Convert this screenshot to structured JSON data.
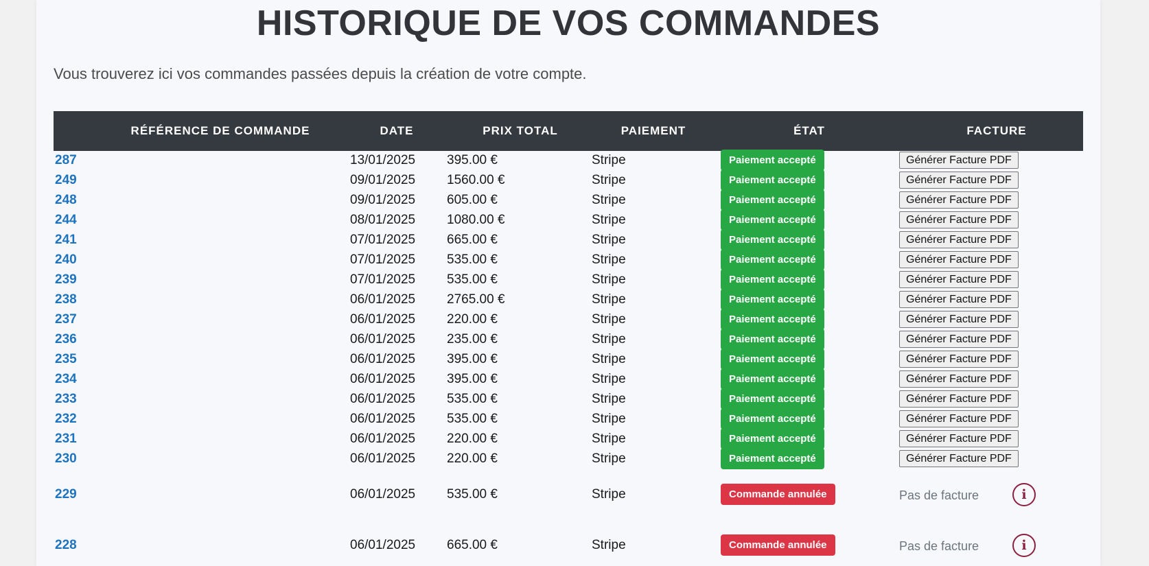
{
  "page": {
    "title": "HISTORIQUE DE VOS COMMANDES",
    "subtitle": "Vous trouverez ici vos commandes passées depuis la création de votre compte."
  },
  "table": {
    "headers": [
      "RÉFÉRENCE DE COMMANDE",
      "DATE",
      "PRIX TOTAL",
      "PAIEMENT",
      "ÉTAT",
      "FACTURE"
    ],
    "rows": [
      {
        "ref": "287",
        "date": "13/01/2025",
        "price": "395.00 €",
        "payment": "Stripe",
        "status": "Paiement accepté",
        "status_type": "accepted",
        "invoice": "Générer Facture PDF"
      },
      {
        "ref": "249",
        "date": "09/01/2025",
        "price": "1560.00 €",
        "payment": "Stripe",
        "status": "Paiement accepté",
        "status_type": "accepted",
        "invoice": "Générer Facture PDF"
      },
      {
        "ref": "248",
        "date": "09/01/2025",
        "price": "605.00 €",
        "payment": "Stripe",
        "status": "Paiement accepté",
        "status_type": "accepted",
        "invoice": "Générer Facture PDF"
      },
      {
        "ref": "244",
        "date": "08/01/2025",
        "price": "1080.00 €",
        "payment": "Stripe",
        "status": "Paiement accepté",
        "status_type": "accepted",
        "invoice": "Générer Facture PDF"
      },
      {
        "ref": "241",
        "date": "07/01/2025",
        "price": "665.00 €",
        "payment": "Stripe",
        "status": "Paiement accepté",
        "status_type": "accepted",
        "invoice": "Générer Facture PDF"
      },
      {
        "ref": "240",
        "date": "07/01/2025",
        "price": "535.00 €",
        "payment": "Stripe",
        "status": "Paiement accepté",
        "status_type": "accepted",
        "invoice": "Générer Facture PDF"
      },
      {
        "ref": "239",
        "date": "07/01/2025",
        "price": "535.00 €",
        "payment": "Stripe",
        "status": "Paiement accepté",
        "status_type": "accepted",
        "invoice": "Générer Facture PDF"
      },
      {
        "ref": "238",
        "date": "06/01/2025",
        "price": "2765.00 €",
        "payment": "Stripe",
        "status": "Paiement accepté",
        "status_type": "accepted",
        "invoice": "Générer Facture PDF"
      },
      {
        "ref": "237",
        "date": "06/01/2025",
        "price": "220.00 €",
        "payment": "Stripe",
        "status": "Paiement accepté",
        "status_type": "accepted",
        "invoice": "Générer Facture PDF"
      },
      {
        "ref": "236",
        "date": "06/01/2025",
        "price": "235.00 €",
        "payment": "Stripe",
        "status": "Paiement accepté",
        "status_type": "accepted",
        "invoice": "Générer Facture PDF"
      },
      {
        "ref": "235",
        "date": "06/01/2025",
        "price": "395.00 €",
        "payment": "Stripe",
        "status": "Paiement accepté",
        "status_type": "accepted",
        "invoice": "Générer Facture PDF"
      },
      {
        "ref": "234",
        "date": "06/01/2025",
        "price": "395.00 €",
        "payment": "Stripe",
        "status": "Paiement accepté",
        "status_type": "accepted",
        "invoice": "Générer Facture PDF"
      },
      {
        "ref": "233",
        "date": "06/01/2025",
        "price": "535.00 €",
        "payment": "Stripe",
        "status": "Paiement accepté",
        "status_type": "accepted",
        "invoice": "Générer Facture PDF"
      },
      {
        "ref": "232",
        "date": "06/01/2025",
        "price": "535.00 €",
        "payment": "Stripe",
        "status": "Paiement accepté",
        "status_type": "accepted",
        "invoice": "Générer Facture PDF"
      },
      {
        "ref": "231",
        "date": "06/01/2025",
        "price": "220.00 €",
        "payment": "Stripe",
        "status": "Paiement accepté",
        "status_type": "accepted",
        "invoice": "Générer Facture PDF"
      },
      {
        "ref": "230",
        "date": "06/01/2025",
        "price": "220.00 €",
        "payment": "Stripe",
        "status": "Paiement accepté",
        "status_type": "accepted",
        "invoice": "Générer Facture PDF"
      },
      {
        "ref": "229",
        "date": "06/01/2025",
        "price": "535.00 €",
        "payment": "Stripe",
        "status": "Commande annulée",
        "status_type": "cancelled",
        "invoice": "Pas de facture",
        "icon": "info-icon",
        "icon_glyph": "i"
      },
      {
        "ref": "228",
        "date": "06/01/2025",
        "price": "665.00 €",
        "payment": "Stripe",
        "status": "Commande annulée",
        "status_type": "cancelled",
        "invoice": "Pas de facture",
        "icon": "info-icon",
        "icon_glyph": "i"
      }
    ]
  },
  "colors": {
    "header_bg": "#343a40",
    "link": "#1e73be",
    "accepted": "#28a745",
    "cancelled": "#dc3545",
    "info_icon": "#8b1f3f"
  }
}
